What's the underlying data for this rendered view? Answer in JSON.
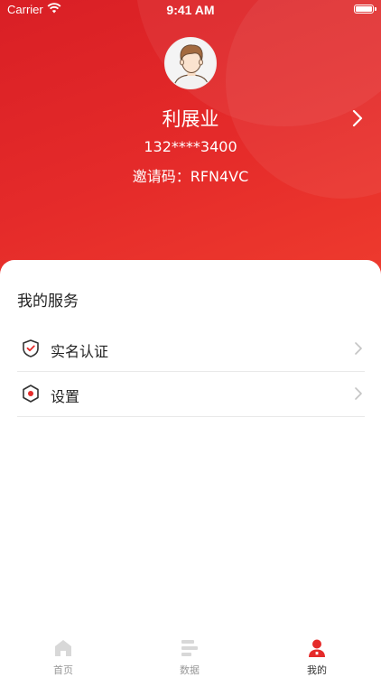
{
  "status_bar": {
    "carrier": "Carrier",
    "time": "9:41 AM"
  },
  "profile": {
    "name": "利展业",
    "phone": "132****3400",
    "invite": "邀请码：RFN4VC"
  },
  "services": {
    "title": "我的服务",
    "items": [
      {
        "label": "实名认证",
        "icon": "shield-check-icon"
      },
      {
        "label": "设置",
        "icon": "settings-hexagon-icon"
      }
    ]
  },
  "tabbar": {
    "tabs": [
      {
        "label": "首页",
        "icon": "home-icon",
        "active": false
      },
      {
        "label": "数据",
        "icon": "data-bars-icon",
        "active": false
      },
      {
        "label": "我的",
        "icon": "person-icon",
        "active": true
      }
    ]
  },
  "colors": {
    "brand_red": "#e52b2a",
    "inactive_icon": "#d8d8d8",
    "text": "#222222"
  }
}
